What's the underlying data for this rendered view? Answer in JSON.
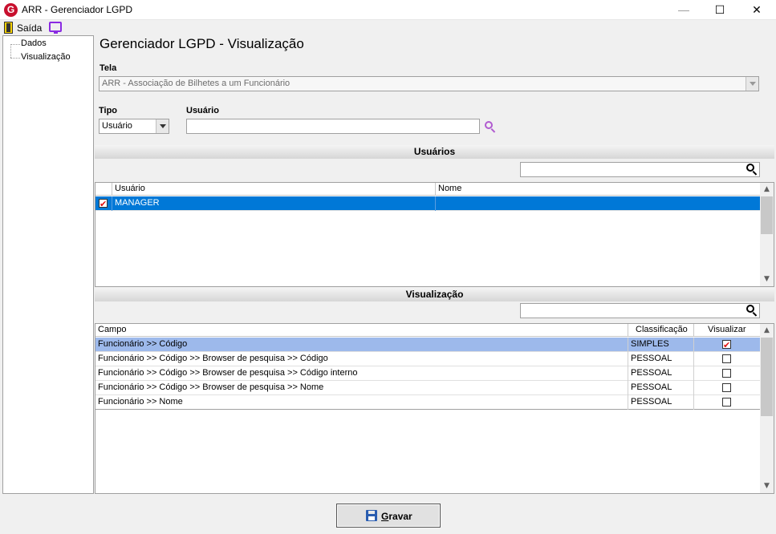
{
  "window": {
    "title": "ARR - Gerenciador LGPD",
    "icon": "app-logo-icon"
  },
  "menubar": {
    "exit_label": "Saída"
  },
  "tree": {
    "items": [
      {
        "label": "Dados"
      },
      {
        "label": "Visualização"
      }
    ]
  },
  "page": {
    "title": "Gerenciador LGPD - Visualização"
  },
  "form": {
    "tela_label": "Tela",
    "tela_value": "ARR - Associação de Bilhetes a um Funcionário",
    "tipo_label": "Tipo",
    "tipo_value": "Usuário",
    "usuario_label": "Usuário",
    "usuario_value": ""
  },
  "users_section": {
    "title": "Usuários",
    "search_value": "",
    "columns": [
      "Usuário",
      "Nome"
    ],
    "rows": [
      {
        "checked": true,
        "usuario": "MANAGER",
        "nome": ""
      }
    ]
  },
  "view_section": {
    "title": "Visualização",
    "search_value": "",
    "columns": [
      "Campo",
      "Classificação",
      "Visualizar"
    ],
    "rows": [
      {
        "campo": "Funcionário >> Código",
        "classificacao": "SIMPLES",
        "visualizar": true
      },
      {
        "campo": "Funcionário >> Código >> Browser de pesquisa >> Código",
        "classificacao": "PESSOAL",
        "visualizar": false
      },
      {
        "campo": "Funcionário >> Código >> Browser de pesquisa >> Código interno",
        "classificacao": "PESSOAL",
        "visualizar": false
      },
      {
        "campo": "Funcionário >> Código >> Browser de pesquisa >> Nome",
        "classificacao": "PESSOAL",
        "visualizar": false
      },
      {
        "campo": "Funcionário >> Nome",
        "classificacao": "PESSOAL",
        "visualizar": false
      }
    ]
  },
  "footer": {
    "save_accel": "G",
    "save_rest": "ravar"
  },
  "colors": {
    "selection_blue": "#0078d7",
    "selection_light": "#9db9eb",
    "check_red": "#e01010",
    "search_purple": "#b05ad0"
  }
}
